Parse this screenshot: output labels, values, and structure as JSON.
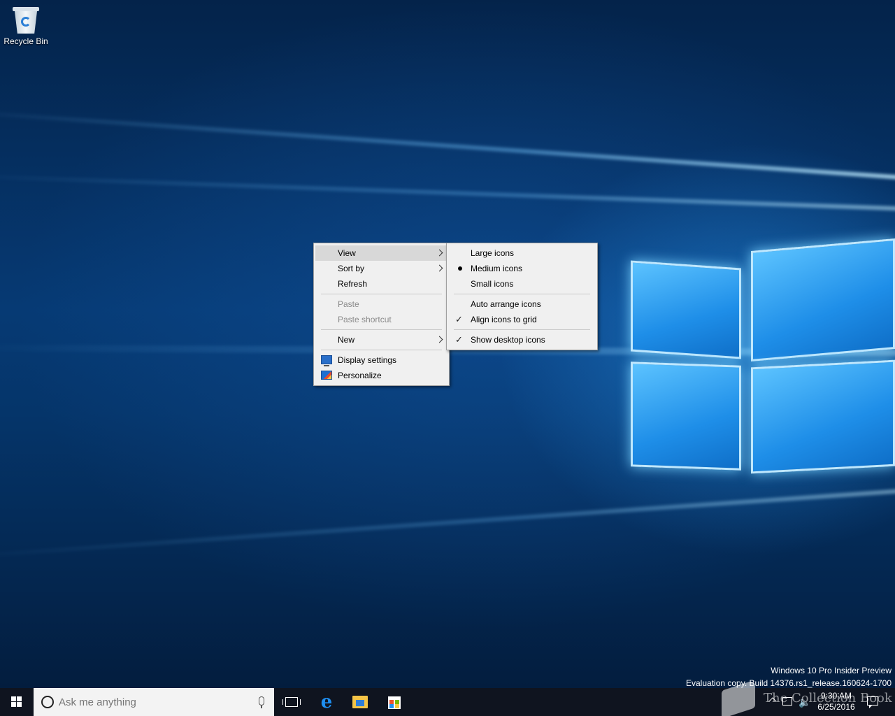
{
  "desktop": {
    "icons": [
      {
        "label": "Recycle Bin",
        "icon": "recycle-bin-icon"
      }
    ]
  },
  "context_menu": {
    "items": [
      {
        "label": "View",
        "submenu": true,
        "highlighted": true
      },
      {
        "label": "Sort by",
        "submenu": true
      },
      {
        "label": "Refresh"
      },
      {
        "separator": true
      },
      {
        "label": "Paste",
        "disabled": true
      },
      {
        "label": "Paste shortcut",
        "disabled": true
      },
      {
        "separator": true
      },
      {
        "label": "New",
        "submenu": true
      },
      {
        "separator": true
      },
      {
        "label": "Display settings",
        "icon": "display-settings-icon"
      },
      {
        "label": "Personalize",
        "icon": "personalize-icon"
      }
    ]
  },
  "view_submenu": {
    "items": [
      {
        "label": "Large icons"
      },
      {
        "label": "Medium icons",
        "selected": "bullet"
      },
      {
        "label": "Small icons"
      },
      {
        "separator": true
      },
      {
        "label": "Auto arrange icons"
      },
      {
        "label": "Align icons to grid",
        "checked": true
      },
      {
        "separator": true
      },
      {
        "label": "Show desktop icons",
        "checked": true
      }
    ]
  },
  "watermark": {
    "line1": "Windows 10 Pro Insider Preview",
    "line2": "Evaluation copy. Build 14376.rs1_release.160624-1700"
  },
  "overlay_brand": "The Collection Book",
  "taskbar": {
    "search_placeholder": "Ask me anything",
    "clock_time": "9:30 AM",
    "clock_date": "6/25/2016"
  },
  "colors": {
    "menu_bg": "#f0f0f0",
    "menu_highlight": "#d8d8d8",
    "taskbar_bg": "#10141e",
    "accent": "#1e8ef0"
  }
}
